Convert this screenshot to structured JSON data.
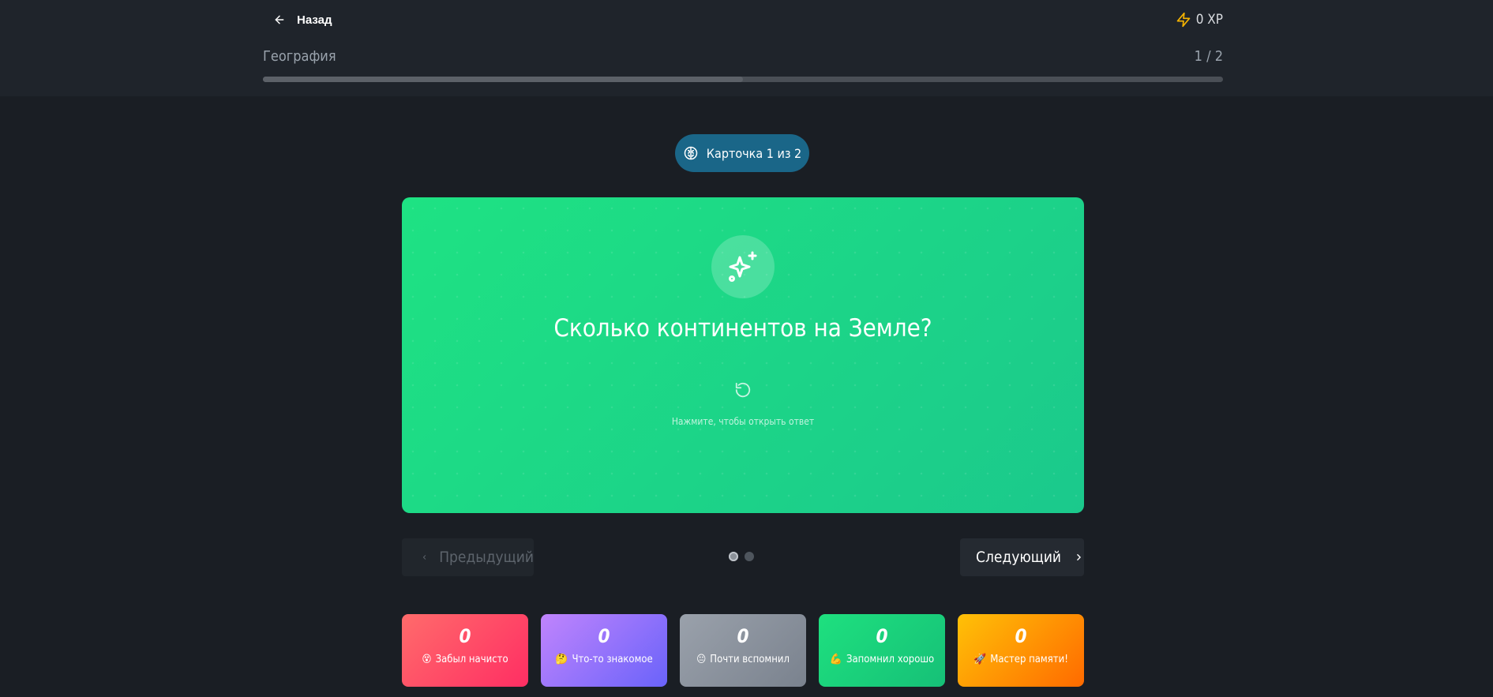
{
  "header": {
    "back_label": "Назад",
    "xp_label": "0 XP",
    "subject": "География",
    "counter": "1 / 2",
    "progress": 0.5
  },
  "card_pill": {
    "label": "Карточка 1 из 2"
  },
  "flashcard": {
    "question": "Сколько континентов на Земле?",
    "hint": "Нажмите, чтобы открыть ответ"
  },
  "navigation": {
    "prev_label": "Предыдущий",
    "next_label": "Следующий",
    "page_count": 2,
    "current_page": 1
  },
  "ratings": [
    {
      "count": "0",
      "emoji": "😵",
      "label": "Забыл начисто"
    },
    {
      "count": "0",
      "emoji": "🤔",
      "label": "Что-то знакомое"
    },
    {
      "count": "0",
      "emoji": "😐",
      "label": "Почти вспомнил"
    },
    {
      "count": "0",
      "emoji": "💪",
      "label": "Запомнил хорошо"
    },
    {
      "count": "0",
      "emoji": "🚀",
      "label": "Мастер памяти!"
    }
  ],
  "colors": {
    "background": "#1a1e24",
    "header": "#1f242b",
    "pill": "#1a6688",
    "card_green": "#1ee283",
    "xp_icon": "#f5b301"
  },
  "icons": {
    "back": "arrow-left-icon",
    "xp": "lightning-icon",
    "pill": "brain-icon",
    "card": "sparkles-icon",
    "flip": "rotate-icon",
    "prev": "chevron-left-icon",
    "next": "chevron-right-icon"
  }
}
